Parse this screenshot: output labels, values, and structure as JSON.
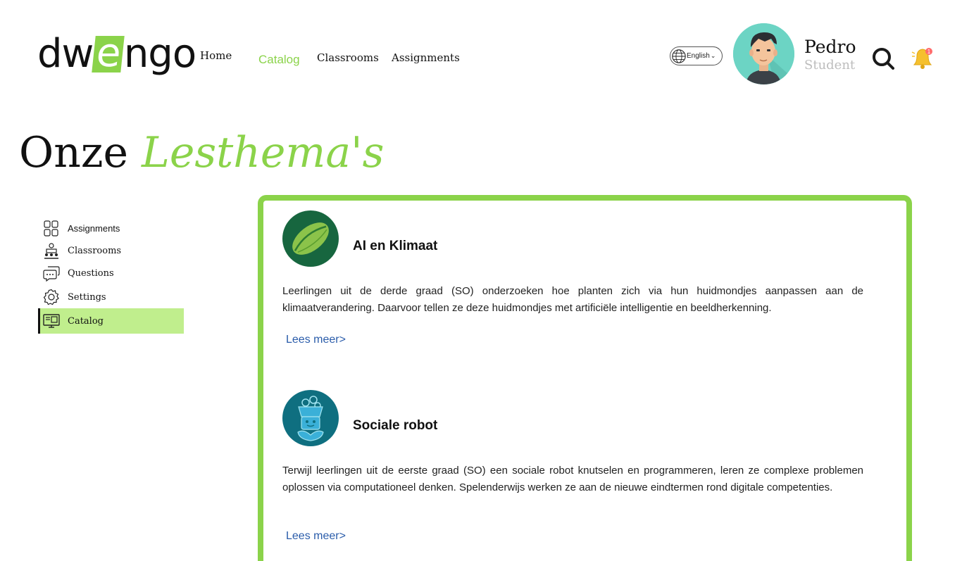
{
  "header": {
    "logo": {
      "part1": "dw",
      "part2": "e",
      "part3": "ngo"
    },
    "nav": [
      {
        "label": "Home",
        "active": false
      },
      {
        "label": "Catalog",
        "active": true
      },
      {
        "label": "Classrooms",
        "active": false
      },
      {
        "label": "Assignments",
        "active": false
      }
    ],
    "language": "English",
    "user": {
      "name": "Pedro",
      "role": "Student"
    },
    "notification_count": "1"
  },
  "page": {
    "title_plain": "Onze",
    "title_accent": "Lesthema's"
  },
  "sidebar": {
    "items": [
      {
        "label": "Assignments",
        "icon": "assignments-icon",
        "active": false
      },
      {
        "label": "Classrooms",
        "icon": "classrooms-icon",
        "active": false
      },
      {
        "label": "Questions",
        "icon": "questions-icon",
        "active": false
      },
      {
        "label": "Settings",
        "icon": "settings-icon",
        "active": false
      },
      {
        "label": "Catalog",
        "icon": "catalog-icon",
        "active": true
      }
    ]
  },
  "catalog": {
    "cards": [
      {
        "title": "AI en Klimaat",
        "icon": "leaf-icon",
        "description": "Leerlingen uit de derde graad (SO) onderzoeken hoe planten zich via hun huidmondjes aanpassen aan de klimaatverandering. Daarvoor tellen ze deze huidmondjes met artificiële intelligentie en beeldherkenning.",
        "link": "Lees meer>"
      },
      {
        "title": "Sociale robot",
        "icon": "robot-icon",
        "description": "Terwijl leerlingen uit de eerste graad (SO) een sociale robot knutselen en programmeren, leren ze complexe problemen oplossen via computationeel denken. Spelenderwijs werken ze aan de nieuwe eindtermen rond digitale competenties.",
        "link": "Lees meer>"
      }
    ]
  },
  "colors": {
    "accent": "#8bd34a",
    "sidebar_active": "#c0ee8d",
    "link": "#2a5caa",
    "card1_icon_bg": "#17663f",
    "card2_icon_bg": "#0f6f80"
  }
}
